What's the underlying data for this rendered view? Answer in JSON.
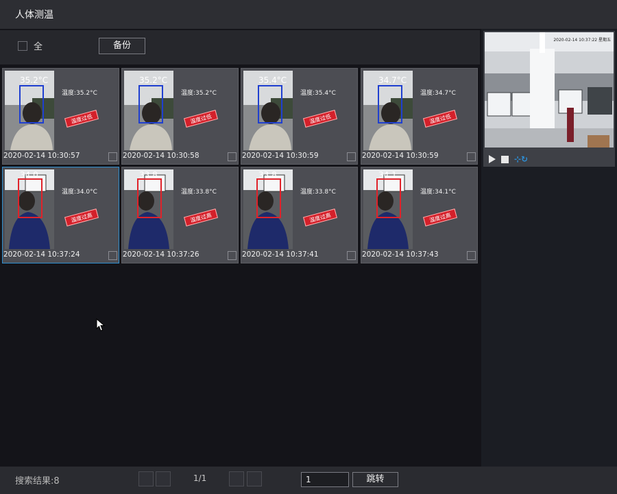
{
  "window": {
    "title": "人体测温"
  },
  "toolbar": {
    "select_all_label": "全",
    "backup_label": "备份"
  },
  "records": [
    {
      "temp": "温度:35.2°C",
      "overlay": "35.2°C",
      "alert": "温度过低",
      "time": "2020-02-14 10:30:57",
      "box_color": "#1f3fd0"
    },
    {
      "temp": "温度:35.2°C",
      "overlay": "35.2°C",
      "alert": "温度过低",
      "time": "2020-02-14 10:30:58",
      "box_color": "#1f3fd0"
    },
    {
      "temp": "温度:35.4°C",
      "overlay": "35.4°C",
      "alert": "温度过低",
      "time": "2020-02-14 10:30:59",
      "box_color": "#1f3fd0"
    },
    {
      "temp": "温度:34.7°C",
      "overlay": "34.7°C",
      "alert": "温度过低",
      "time": "2020-02-14 10:30:59",
      "box_color": "#1f3fd0"
    },
    {
      "temp": "温度:34.0°C",
      "overlay": "34.0",
      "alert": "温度过高",
      "time": "2020-02-14 10:37:24",
      "box_color": "#e0222a",
      "selected": true
    },
    {
      "temp": "温度:33.8°C",
      "overlay": "33.8",
      "alert": "温度过高",
      "time": "2020-02-14 10:37:26",
      "box_color": "#e0222a"
    },
    {
      "temp": "温度:33.8°C",
      "overlay": "33.8",
      "alert": "温度过高",
      "time": "2020-02-14 10:37:41",
      "box_color": "#e0222a"
    },
    {
      "temp": "温度:34.1°C",
      "overlay": "34.1",
      "alert": "温度过高",
      "time": "2020-02-14 10:37:43",
      "box_color": "#e0222a"
    }
  ],
  "preview": {
    "timestamp": "2020-02-14 10:37:22 星期五"
  },
  "status": {
    "result_label": "搜索结果:8",
    "page_indicator": "1/1",
    "page_input_value": "1",
    "jump_label": "跳转"
  }
}
